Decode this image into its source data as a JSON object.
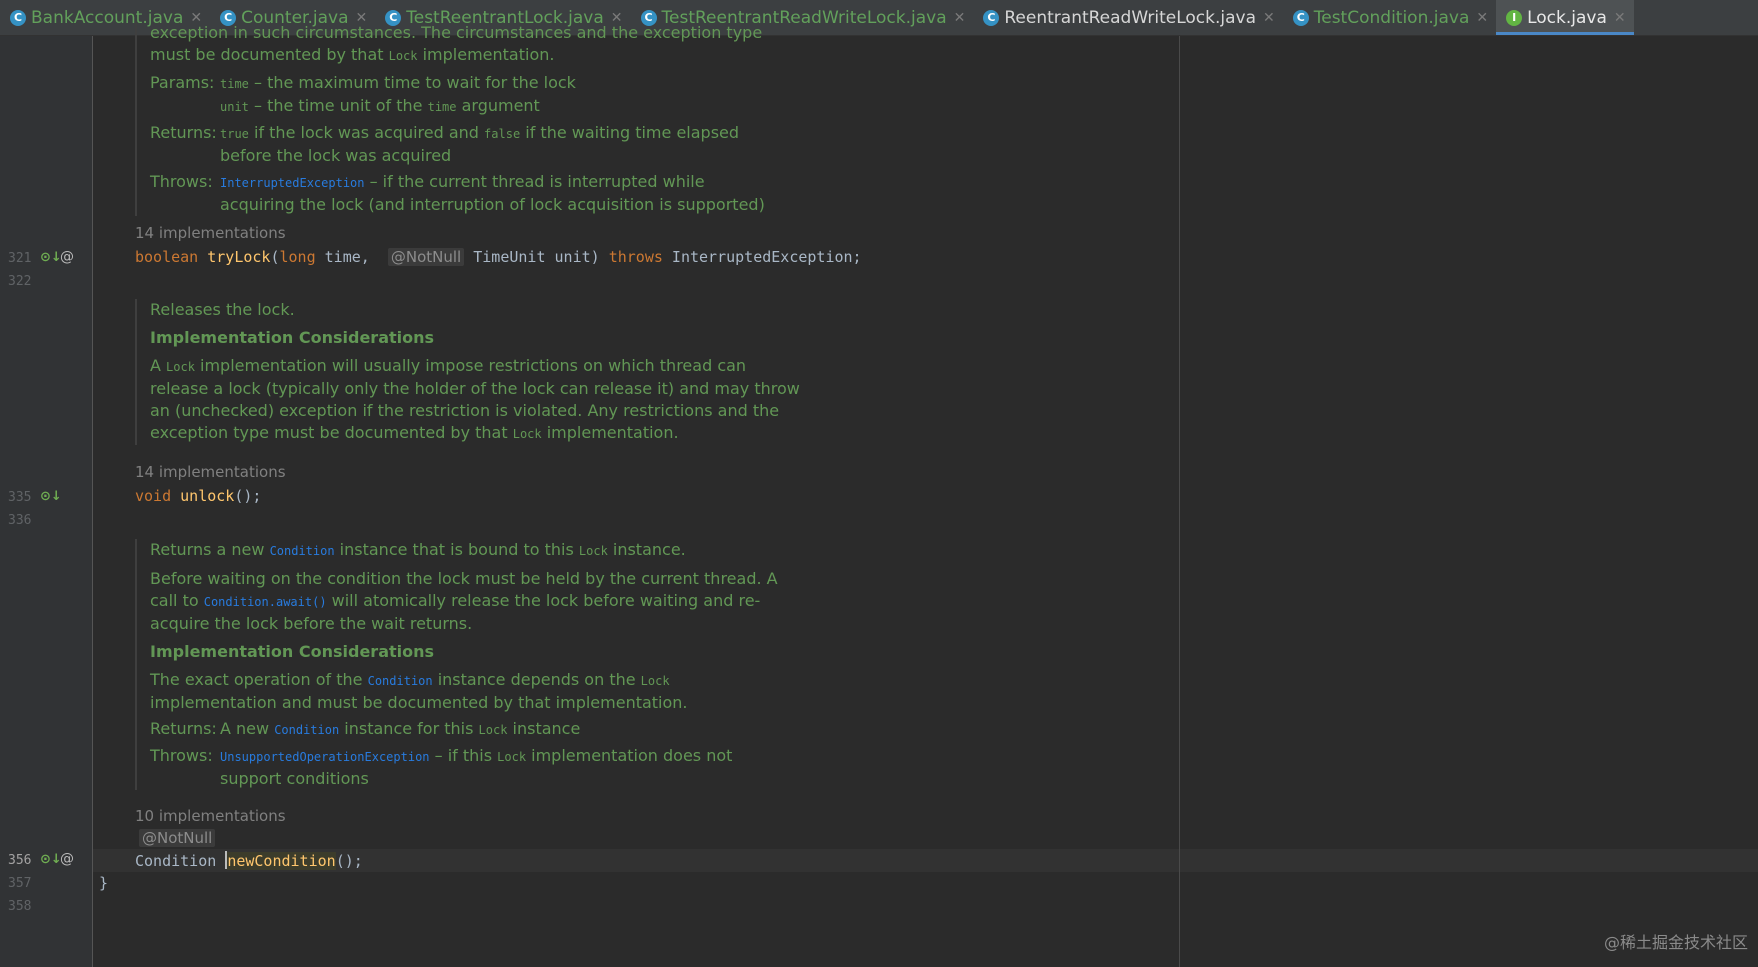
{
  "tabs": [
    {
      "label": "BankAccount.java",
      "icon": "class-icon",
      "state": "normal"
    },
    {
      "label": "Counter.java",
      "icon": "class-icon",
      "state": "normal"
    },
    {
      "label": "TestReentrantLock.java",
      "icon": "class-icon",
      "state": "normal"
    },
    {
      "label": "TestReentrantReadWriteLock.java",
      "icon": "class-icon",
      "state": "normal"
    },
    {
      "label": "ReentrantReadWriteLock.java",
      "icon": "class-icon",
      "state": "selected"
    },
    {
      "label": "TestCondition.java",
      "icon": "class-icon",
      "state": "normal"
    },
    {
      "label": "Lock.java",
      "icon": "interface-icon",
      "state": "active"
    }
  ],
  "gutter": {
    "lines": [
      "321",
      "322",
      "335",
      "336",
      "356",
      "357",
      "358"
    ]
  },
  "doc_trylock": {
    "top_line1": "exception in such circumstances. The circumstances and the exception type",
    "top_line2a": "must be documented by that ",
    "top_line2_code": "Lock",
    "top_line2b": " implementation.",
    "params_label": "Params:",
    "param1_name": "time",
    "param1_desc": " – the maximum time to wait for the lock",
    "param2_name": "unit",
    "param2_desc_a": " – the time unit of the ",
    "param2_code": "time",
    "param2_desc_b": " argument",
    "returns_label": "Returns:",
    "returns_true": "true",
    "returns_mid": " if the lock was acquired and ",
    "returns_false": "false",
    "returns_end": " if the waiting time elapsed",
    "returns_line2": "before the lock was acquired",
    "throws_label": "Throws:",
    "throws_link": "InterruptedException",
    "throws_desc": " – if the current thread is interrupted while",
    "throws_line2": "acquiring the lock (and interruption of lock acquisition is supported)"
  },
  "impl_count_1": "14 implementations",
  "code_trylock": {
    "kw_boolean": "boolean",
    "name": "tryLock",
    "open": "(",
    "kw_long": "long",
    "arg1": " time, ",
    "annotation": "@NotNull",
    "arg2": " TimeUnit unit) ",
    "kw_throws": "throws",
    "exc": " InterruptedException;"
  },
  "doc_unlock": {
    "summary": "Releases the lock.",
    "heading": "Implementation Considerations",
    "p1a": "A ",
    "p1_code": "Lock",
    "p1b": " implementation will usually impose restrictions on which thread can",
    "p2": "release a lock (typically only the holder of the lock can release it) and may throw",
    "p3": "an (unchecked) exception if the restriction is violated. Any restrictions and the",
    "p4a": "exception type must be documented by that ",
    "p4_code": "Lock",
    "p4b": " implementation."
  },
  "impl_count_2": "14 implementations",
  "code_unlock": {
    "kw_void": "void",
    "name": "unlock",
    "rest": "();"
  },
  "doc_newcondition": {
    "s1a": "Returns a new ",
    "s1_code": "Condition",
    "s1b": " instance that is bound to this ",
    "s1_code2": "Lock",
    "s1c": " instance.",
    "p1": "Before waiting on the condition the lock must be held by the current thread. A",
    "p2a": "call to ",
    "p2_code": "Condition.await()",
    "p2b": " will atomically release the lock before waiting and re-",
    "p3": "acquire the lock before the wait returns.",
    "heading": "Implementation Considerations",
    "q1a": "The exact operation of the ",
    "q1_code": "Condition",
    "q1b": " instance depends on the ",
    "q1_code2": "Lock",
    "q2": "implementation and must be documented by that implementation.",
    "returns_label": "Returns:",
    "returns_a": "A new ",
    "returns_code": "Condition",
    "returns_b": " instance for this ",
    "returns_code2": "Lock",
    "returns_c": " instance",
    "throws_label": "Throws:",
    "throws_link": "UnsupportedOperationException",
    "throws_a": " – if this ",
    "throws_code": "Lock",
    "throws_b": " implementation does not",
    "throws_line2": "support conditions"
  },
  "impl_count_3": "10 implementations",
  "annotation_notnull": "@NotNull",
  "code_newcondition": {
    "type": "Condition ",
    "name_first": "n",
    "name_rest": "ewCondition",
    "rest": "();"
  },
  "closing_brace": "}",
  "watermark": "@稀土掘金技术社区"
}
